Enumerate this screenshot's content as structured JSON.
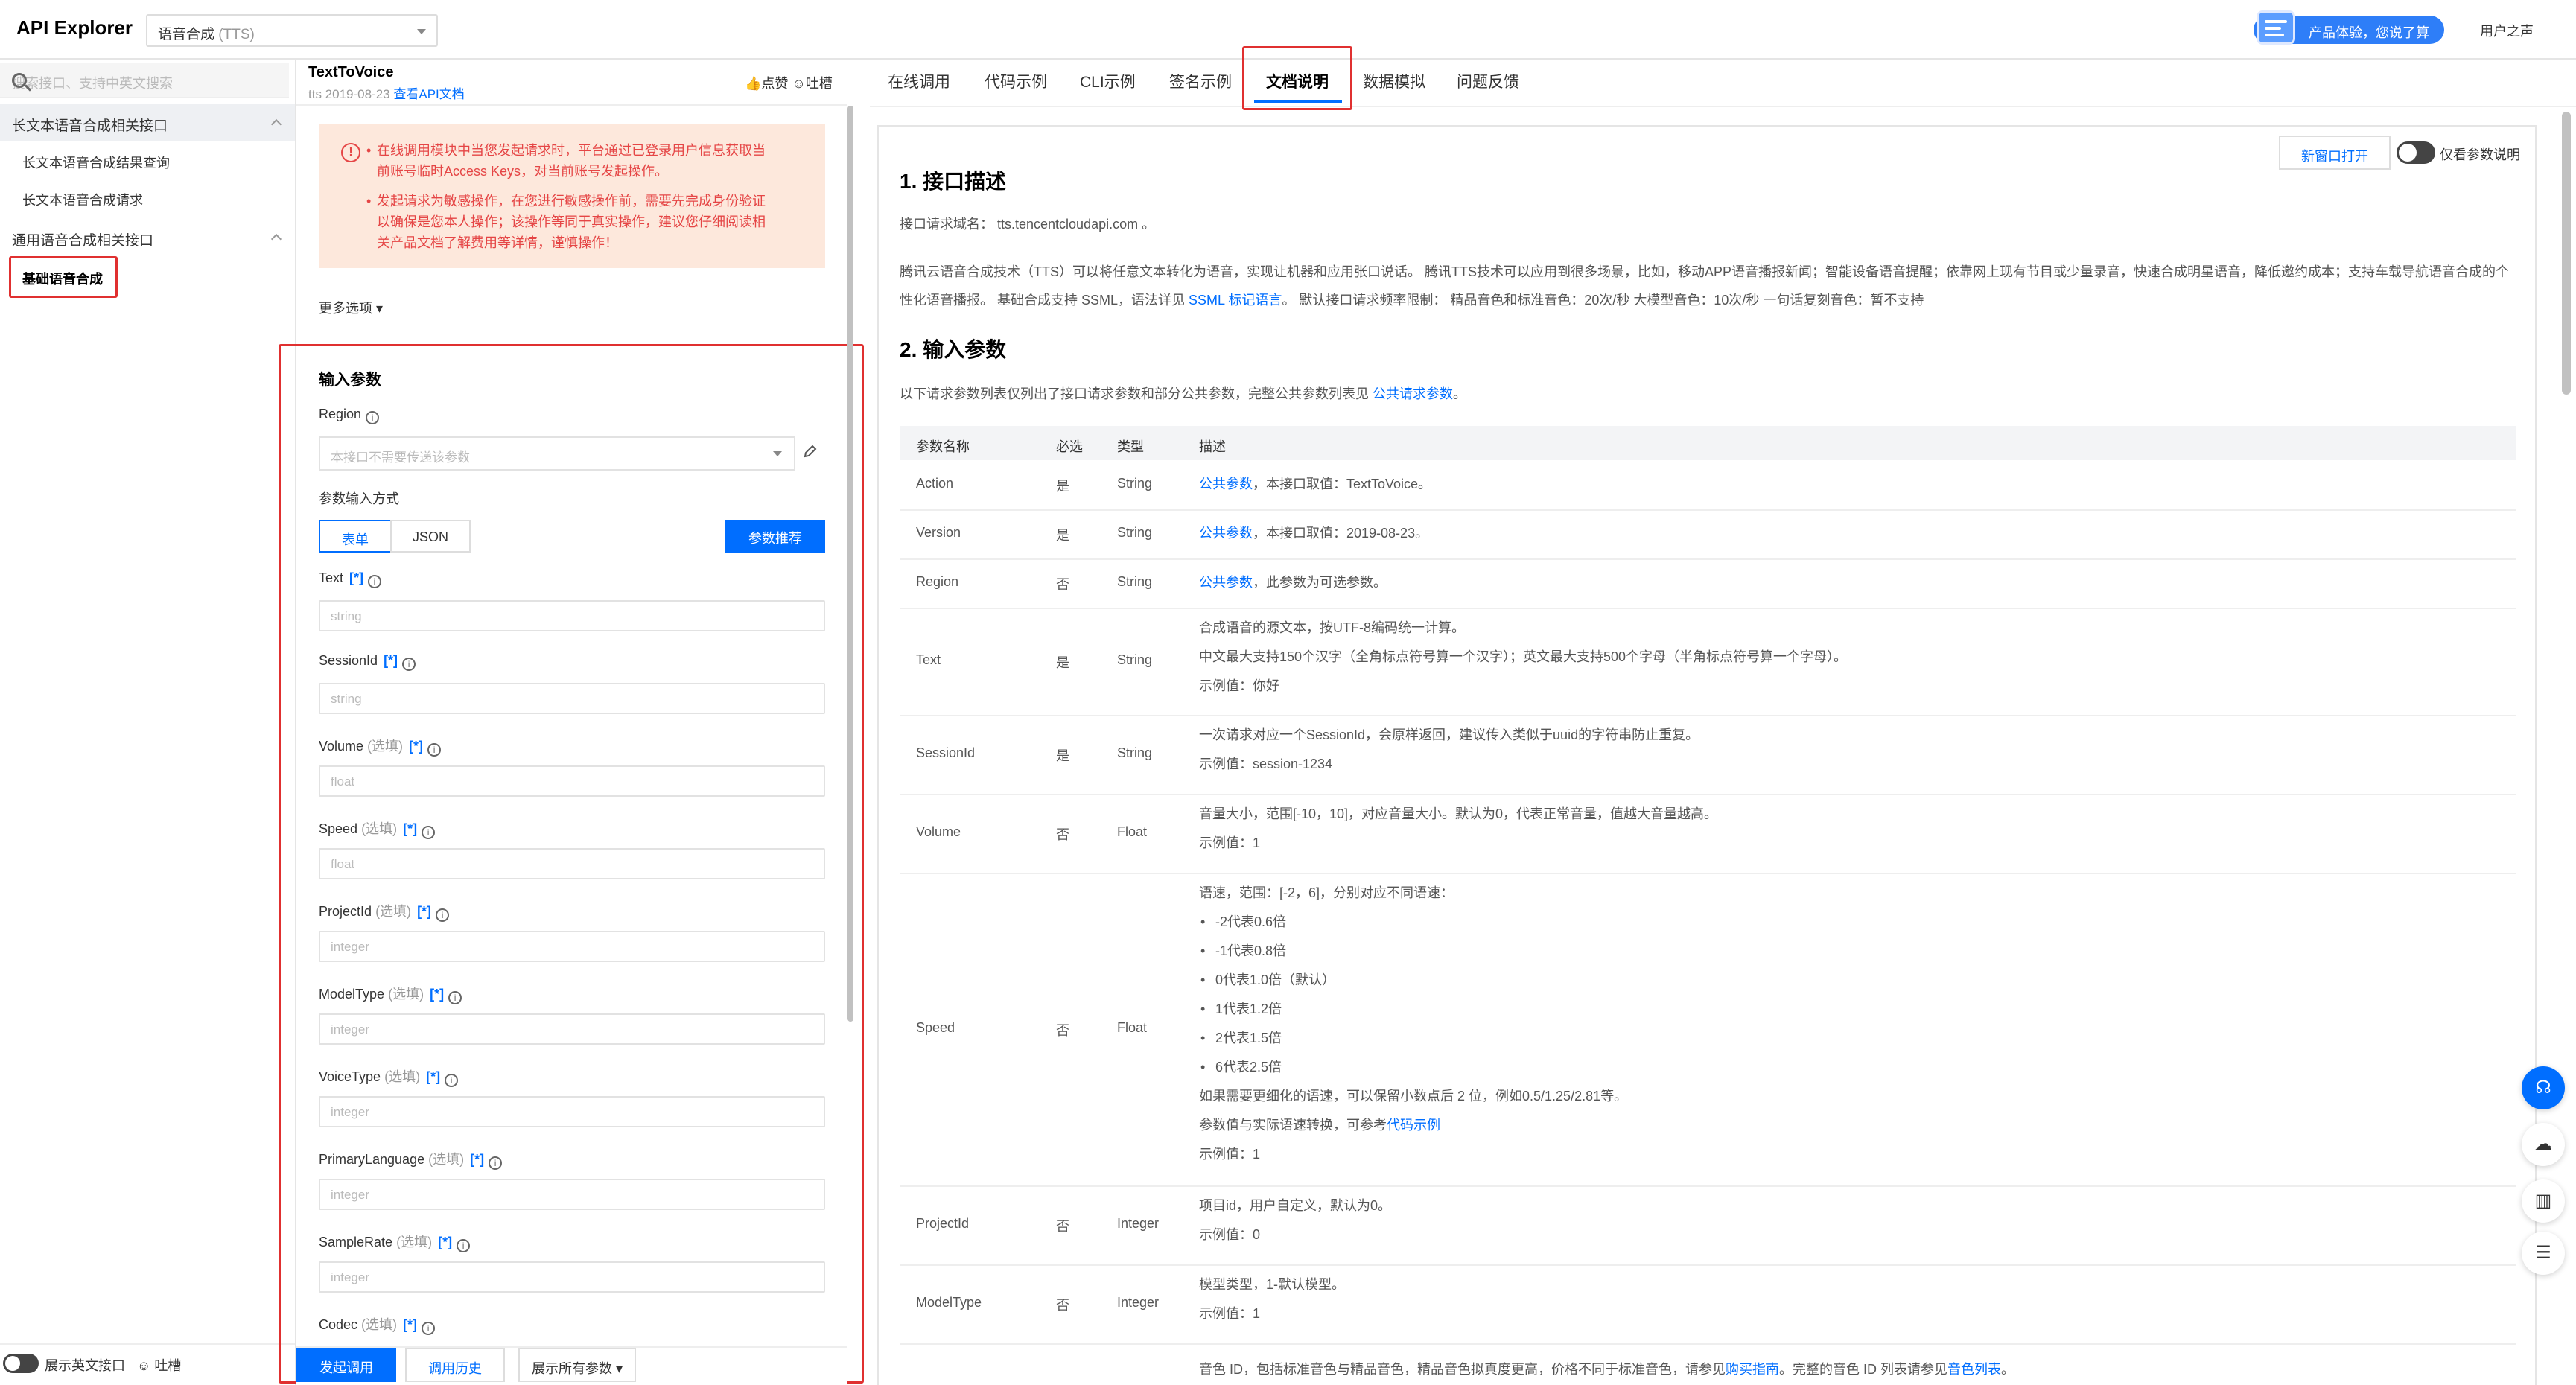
{
  "header": {
    "brand": "API Explorer",
    "service_name": "语音合成",
    "service_code": "(TTS)",
    "promo_label": "产品体验，您说了算",
    "user_voice": "用户之声"
  },
  "sidebar": {
    "search_placeholder": "搜索接口、支持中英文搜索",
    "groups": [
      {
        "label": "长文本语音合成相关接口",
        "items": [
          "长文本语音合成结果查询",
          "长文本语音合成请求"
        ]
      },
      {
        "label": "通用语音合成相关接口",
        "items": [
          "基础语音合成"
        ]
      }
    ],
    "footer_toggle_label": "展示英文接口",
    "footer_feedback": "吐槽"
  },
  "api": {
    "name": "TextToVoice",
    "version_prefix": "tts 2019-08-23",
    "doc_link": "查看API文档",
    "like": "点赞",
    "complain": "吐槽"
  },
  "warning": {
    "line1": "在线调用模块中当您发起请求时，平台通过已登录用户信息获取当前账号临时Access Keys，对当前账号发起操作。",
    "line1a": "在线调用模块中当您发起请求时，平台通过已登录用户信息获取当",
    "line1b": "前账号临时Access Keys，对当前账号发起操作。",
    "line2a": "发起请求为敏感操作，在您进行敏感操作前，需要先完成身份验证",
    "line2b": "以确保是您本人操作；该操作等同于真实操作，建议您仔细阅读相",
    "line2c": "关产品文档了解费用等详情，谨慎操作！"
  },
  "form": {
    "more_options": "更多选项",
    "title": "输入参数",
    "region_label": "Region",
    "region_placeholder": "本接口不需要传递该参数",
    "input_mode_label": "参数输入方式",
    "mode_form": "表单",
    "mode_json": "JSON",
    "recommend": "参数推荐",
    "optional_tag": "(选填)",
    "star": "[*]",
    "fields": [
      {
        "name": "Text",
        "optional": false,
        "type": "string"
      },
      {
        "name": "SessionId",
        "optional": false,
        "type": "string"
      },
      {
        "name": "Volume",
        "optional": true,
        "type": "float"
      },
      {
        "name": "Speed",
        "optional": true,
        "type": "float"
      },
      {
        "name": "ProjectId",
        "optional": true,
        "type": "integer"
      },
      {
        "name": "ModelType",
        "optional": true,
        "type": "integer"
      },
      {
        "name": "VoiceType",
        "optional": true,
        "type": "integer"
      },
      {
        "name": "PrimaryLanguage",
        "optional": true,
        "type": "integer"
      },
      {
        "name": "SampleRate",
        "optional": true,
        "type": "integer"
      },
      {
        "name": "Codec",
        "optional": true,
        "type": ""
      }
    ],
    "submit": "发起调用",
    "history": "调用历史",
    "show_all": "展示所有参数"
  },
  "tabs": [
    "在线调用",
    "代码示例",
    "CLI示例",
    "签名示例",
    "文档说明",
    "数据模拟",
    "问题反馈"
  ],
  "active_tab": "文档说明",
  "doc": {
    "new_window": "新窗口打开",
    "only_params": "仅看参数说明",
    "h1": "1. 接口描述",
    "domain_line": "接口请求域名： tts.tencentcloudapi.com 。",
    "desc_line1": "腾讯云语音合成技术（TTS）可以将任意文本转化为语音，实现让机器和应用张口说话。 腾讯TTS技术可以应用到很多场景，比如，移动APP语音播报新闻；智能设备语音提醒；依靠网上现有节目或少量录音，快速合成明星语音，降低邀约成本；支持车载导航语音合成的个",
    "desc_line2_pre": "性化语音播报。 基础合成支持 SSML，语法详见 ",
    "desc_line2_link": "SSML 标记语言",
    "desc_line2_post": "。 默认接口请求频率限制： 精品音色和标准音色：20次/秒 大模型音色：10次/秒 一句话复刻音色：暂不支持",
    "h2": "2. 输入参数",
    "params_intro_pre": "以下请求参数列表仅列出了接口请求参数和部分公共参数，完整公共参数列表见 ",
    "params_intro_link": "公共请求参数",
    "params_intro_post": "。",
    "columns": [
      "参数名称",
      "必选",
      "类型",
      "描述"
    ],
    "public_param": "公共参数",
    "rows": [
      {
        "name": "Action",
        "req": "是",
        "type": "String",
        "desc": "，本接口取值：TextToVoice。"
      },
      {
        "name": "Version",
        "req": "是",
        "type": "String",
        "desc": "，本接口取值：2019-08-23。"
      },
      {
        "name": "Region",
        "req": "否",
        "type": "String",
        "desc": "，此参数为可选参数。"
      },
      {
        "name": "Text",
        "req": "是",
        "type": "String",
        "lines": [
          "合成语音的源文本，按UTF-8编码统一计算。",
          "中文最大支持150个汉字（全角标点符号算一个汉字）；英文最大支持500个字母（半角标点符号算一个字母）。",
          "示例值：你好"
        ]
      },
      {
        "name": "SessionId",
        "req": "是",
        "type": "String",
        "lines": [
          "一次请求对应一个SessionId，会原样返回，建议传入类似于uuid的字符串防止重复。",
          "示例值：session-1234"
        ]
      },
      {
        "name": "Volume",
        "req": "否",
        "type": "Float",
        "lines": [
          "音量大小，范围[-10，10]，对应音量大小。默认为0，代表正常音量，值越大音量越高。",
          "示例值：1"
        ]
      },
      {
        "name": "Speed",
        "req": "否",
        "type": "Float",
        "intro": "语速，范围：[-2，6]，分别对应不同语速：",
        "bullets": [
          "-2代表0.6倍",
          "-1代表0.8倍",
          "0代表1.0倍（默认）",
          "1代表1.2倍",
          "2代表1.5倍",
          "6代表2.5倍"
        ],
        "after1": "如果需要更细化的语速，可以保留小数点后 2 位，例如0.5/1.25/2.81等。",
        "after2_pre": "参数值与实际语速转换，可参考",
        "after2_link": "代码示例",
        "example": "示例值：1"
      },
      {
        "name": "ProjectId",
        "req": "否",
        "type": "Integer",
        "lines": [
          "项目id，用户自定义，默认为0。",
          "示例值：0"
        ]
      },
      {
        "name": "ModelType",
        "req": "否",
        "type": "Integer",
        "lines": [
          "模型类型，1-默认模型。",
          "示例值：1"
        ]
      }
    ],
    "voice_row_pre": "音色 ID，包括标准音色与精品音色，精品音色拟真度更高，价格不同于标准音色，请参见",
    "voice_row_link1": "购买指南",
    "voice_row_mid": "。完整的音色 ID 列表请参见",
    "voice_row_link2": "音色列表",
    "voice_row_post": "。"
  },
  "colors": {
    "accent": "#006eff",
    "warning_bg": "#fde8dc",
    "warning_text": "#e54545",
    "highlight": "#e03030"
  }
}
